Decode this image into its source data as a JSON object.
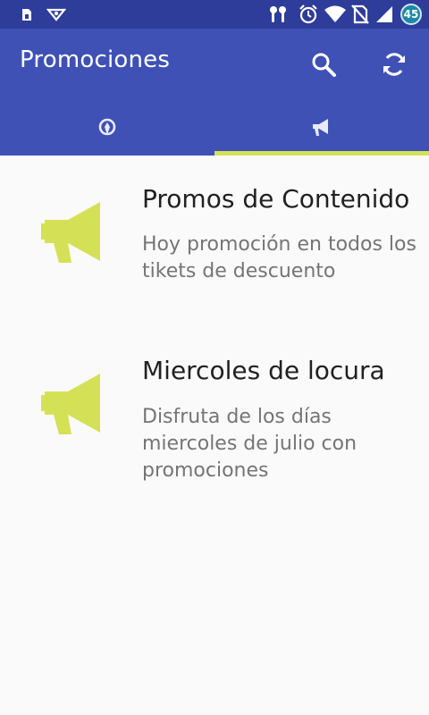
{
  "status_bar": {
    "battery_level": "45",
    "icons": [
      "sim-card-icon",
      "brand-icon",
      "earbuds-icon",
      "alarm-icon",
      "wifi-icon",
      "no-sim-icon",
      "signal-icon"
    ]
  },
  "app_bar": {
    "title": "Promociones",
    "actions": [
      "search-icon",
      "refresh-icon"
    ]
  },
  "tabs": [
    {
      "icon": "map-pin-icon",
      "selected": false
    },
    {
      "icon": "megaphone-icon",
      "selected": true
    }
  ],
  "promos": [
    {
      "title": "Promos de Contenido",
      "description": "Hoy promoción en todos los tikets de descuento",
      "icon": "megaphone-icon"
    },
    {
      "title": "Miercoles de locura",
      "description": "Disfruta de los días miercoles de julio con promociones",
      "icon": "megaphone-icon"
    }
  ],
  "colors": {
    "status_bar": "#2e3c9a",
    "primary": "#3f51b5",
    "accent": "#d4e157",
    "title_text": "#212121",
    "secondary_text": "#757575",
    "background": "#fafafa"
  }
}
